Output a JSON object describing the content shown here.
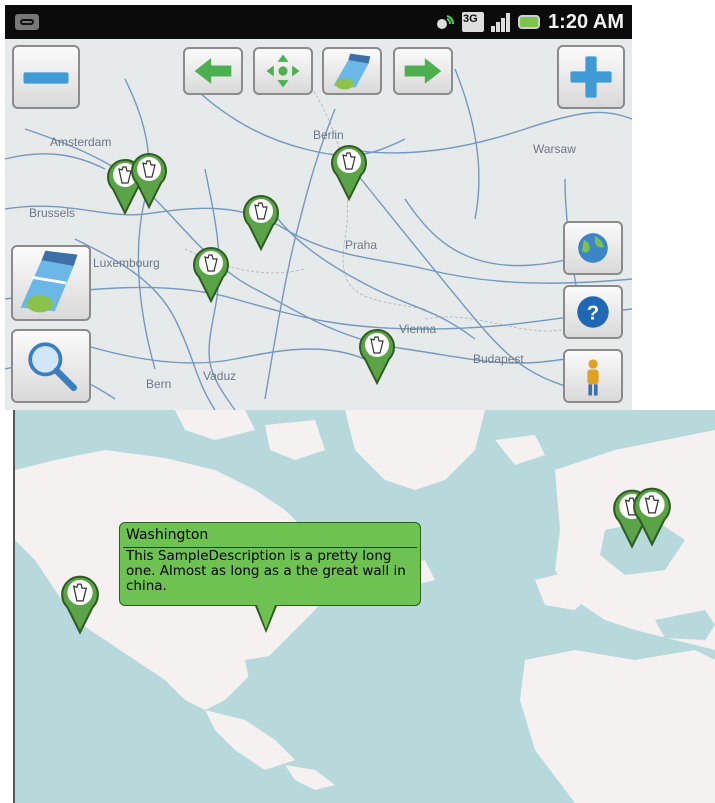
{
  "status_bar": {
    "time": "1:20 AM",
    "network_badge": "3G",
    "icons": [
      "voicemail-icon",
      "gps-icon",
      "3g-icon",
      "signal-icon",
      "battery-icon"
    ]
  },
  "top_map": {
    "cities": [
      "Amsterdam",
      "Berlin",
      "Warsaw",
      "Brussels",
      "Luxembourg",
      "Praha",
      "Vienna",
      "Budapest",
      "Bern",
      "Vaduz"
    ],
    "controls": [
      "zoom-out-button",
      "previous-button",
      "center-button",
      "layers-button",
      "next-button",
      "zoom-in-button",
      "world-button",
      "help-button",
      "person-button",
      "layer-toggle-button",
      "search-button"
    ]
  },
  "balloon": {
    "title": "Washington",
    "description": "This SampleDescription is a pretty long one. Almost as long as a the great wall in china."
  },
  "colors": {
    "pin_green": "#5aa346",
    "balloon_green": "#6ec251",
    "ocean": "#b7d9dc",
    "land": "#f6f1f1",
    "arrow_green": "#4caf50",
    "plus_blue": "#3f9ad6"
  }
}
